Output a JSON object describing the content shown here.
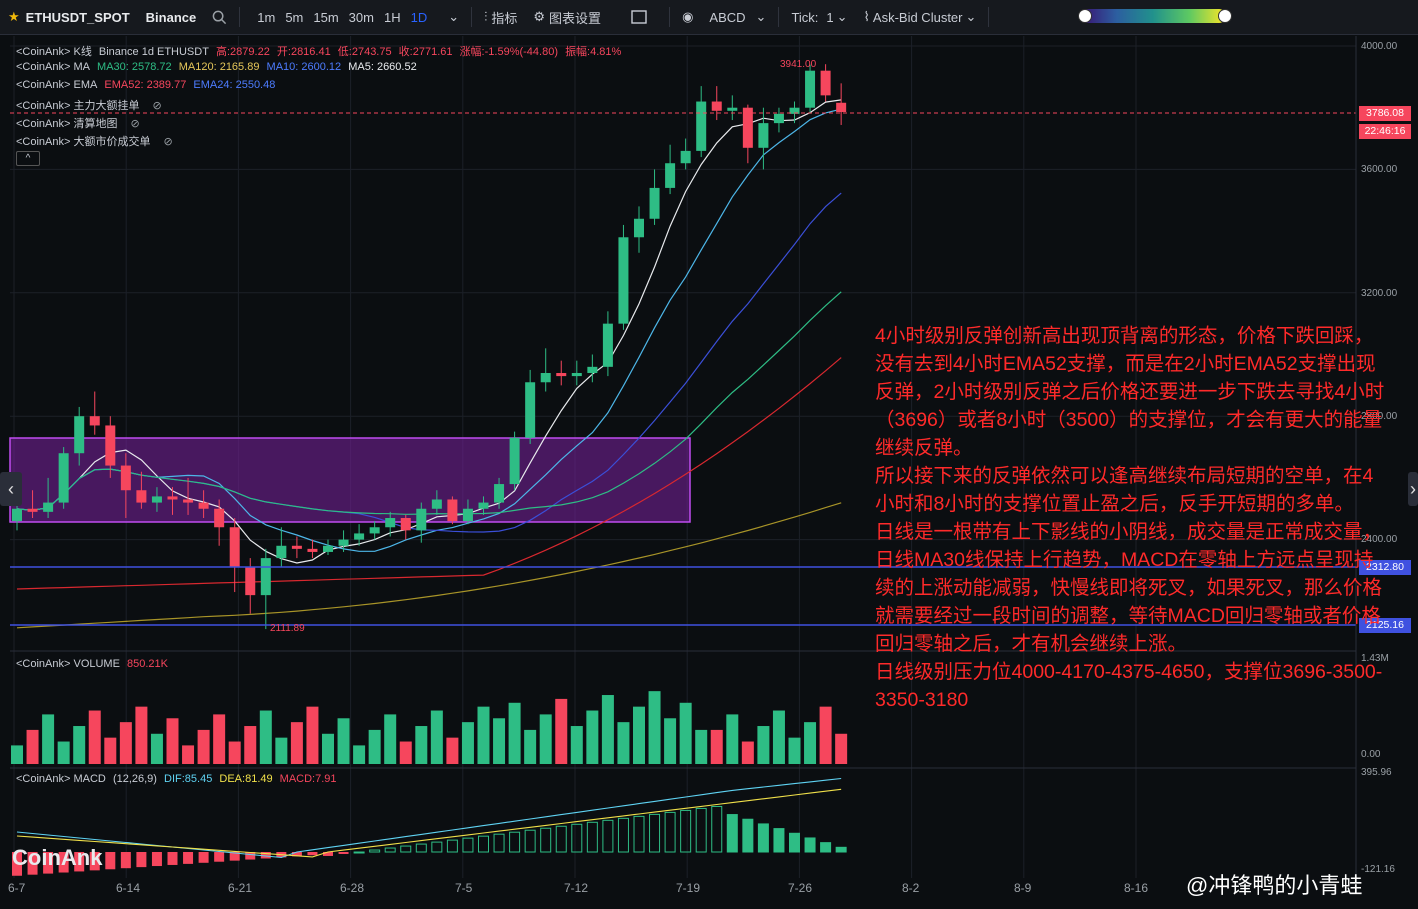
{
  "toolbar": {
    "symbol": "ETHUSDT_SPOT",
    "exchange": "Binance",
    "timeframes": [
      "1m",
      "5m",
      "15m",
      "30m",
      "1H",
      "1D"
    ],
    "active_timeframe": "1D",
    "indicators_label": "指标",
    "chart_settings_label": "图表设置",
    "drawing_label": "ABCD",
    "tick_label": "Tick:",
    "tick_value": "1",
    "cluster_label": "Ask-Bid Cluster"
  },
  "legend": {
    "kline": {
      "prefix": "<CoinAnk> K线",
      "source": "Binance 1d ETHUSDT",
      "high": "高:2879.22",
      "open": "开:2816.41",
      "low": "低:2743.75",
      "close": "收:2771.61",
      "change": "涨幅:-1.59%(-44.80)",
      "amp": "振幅:4.81%"
    },
    "ma": {
      "prefix": "<CoinAnk> MA",
      "ma30": "MA30: 2578.72",
      "ma120": "MA120: 2165.89",
      "ma10": "MA10: 2600.12",
      "ma5": "MA5: 2660.52"
    },
    "ema": {
      "prefix": "<CoinAnk> EMA",
      "ema52": "EMA52: 2389.77",
      "ema24": "EMA24: 2550.48"
    },
    "big_orders": "<CoinAnk> 主力大额挂单",
    "liq_map": "<CoinAnk> 清算地图",
    "big_trades": "<CoinAnk> 大额市价成交单",
    "volume_prefix": "<CoinAnk> VOLUME",
    "volume_value": "850.21K",
    "macd_prefix": "<CoinAnk> MACD",
    "macd_params": "(12,26,9)",
    "dif": "DIF:85.45",
    "dea": "DEA:81.49",
    "macd": "MACD:7.91"
  },
  "y_axis": [
    "4000.00",
    "3600.00",
    "3200.00",
    "2800.00",
    "2400.00"
  ],
  "price_tags": {
    "last": "3786.08",
    "time": "22:46:16",
    "level1": "2312.80",
    "level2": "2125.16",
    "high_mark": "3941.00",
    "low_mark": "2111.89"
  },
  "volume_axis": [
    "1.43M",
    "0.00"
  ],
  "macd_axis": [
    "395.96",
    "-121.16"
  ],
  "x_axis": [
    "6-7",
    "6-14",
    "6-21",
    "6-28",
    "7-5",
    "7-12",
    "7-19",
    "7-26",
    "8-2",
    "8-9",
    "8-16"
  ],
  "note": [
    "4小时级别反弹创新高出现顶背离的形态，价格下跌回踩，没有去到4小时EMA52支撑，而是在2小时EMA52支撑出现反弹，2小时级别反弹之后价格还要进一步下跌去寻找4小时（3696）或者8小时（3500）的支撑位，才会有更大的能量继续反弹。",
    "所以接下来的反弹依然可以逢高继续布局短期的空单，在4小时和8小时的支撑位置止盈之后，反手开短期的多单。",
    "日线是一根带有上下影线的小阴线，成交量是正常成交量，日线MA30线保持上行趋势，MACD在零轴上方远点呈现持续的上涨动能减弱，快慢线即将死叉，如果死叉，那么价格就需要经过一段时间的调整，等待MACD回归零轴或者价格回归零轴之后，才有机会继续上涨。",
    "日线级别压力位4000-4170-4375-4650，支撑位3696-3500-3350-3180"
  ],
  "watermark": "CoinAnk",
  "author": "@冲锋鸭的小青蛙",
  "colors": {
    "up": "#2ebd85",
    "down": "#f6465d",
    "box": "#7b2fa0",
    "level": "#3f51e0"
  },
  "chart_data": {
    "type": "candlestick",
    "note": "ETHUSDT daily candles, values estimated from price axis",
    "candles": [
      [
        2460,
        2500,
        2430,
        2530
      ],
      [
        2500,
        2490,
        2470,
        2560
      ],
      [
        2490,
        2520,
        2470,
        2600
      ],
      [
        2520,
        2680,
        2500,
        2700
      ],
      [
        2680,
        2800,
        2640,
        2830
      ],
      [
        2800,
        2770,
        2740,
        2880
      ],
      [
        2770,
        2640,
        2600,
        2800
      ],
      [
        2640,
        2560,
        2470,
        2680
      ],
      [
        2560,
        2520,
        2500,
        2620
      ],
      [
        2520,
        2540,
        2490,
        2570
      ],
      [
        2540,
        2530,
        2480,
        2570
      ],
      [
        2530,
        2520,
        2480,
        2600
      ],
      [
        2520,
        2500,
        2470,
        2560
      ],
      [
        2500,
        2440,
        2380,
        2530
      ],
      [
        2440,
        2310,
        2230,
        2470
      ],
      [
        2310,
        2220,
        2160,
        2340
      ],
      [
        2220,
        2340,
        2110,
        2370
      ],
      [
        2340,
        2380,
        2310,
        2440
      ],
      [
        2380,
        2370,
        2340,
        2410
      ],
      [
        2370,
        2360,
        2340,
        2400
      ],
      [
        2360,
        2380,
        2350,
        2400
      ],
      [
        2380,
        2400,
        2360,
        2430
      ],
      [
        2400,
        2420,
        2380,
        2450
      ],
      [
        2420,
        2440,
        2400,
        2460
      ],
      [
        2440,
        2470,
        2410,
        2490
      ],
      [
        2470,
        2430,
        2400,
        2480
      ],
      [
        2430,
        2500,
        2390,
        2520
      ],
      [
        2500,
        2530,
        2480,
        2560
      ],
      [
        2530,
        2460,
        2450,
        2540
      ],
      [
        2460,
        2500,
        2450,
        2530
      ],
      [
        2500,
        2520,
        2480,
        2540
      ],
      [
        2520,
        2580,
        2500,
        2600
      ],
      [
        2580,
        2730,
        2560,
        2750
      ],
      [
        2730,
        2910,
        2710,
        2950
      ],
      [
        2910,
        2940,
        2880,
        3020
      ],
      [
        2940,
        2930,
        2900,
        2980
      ],
      [
        2930,
        2940,
        2900,
        2980
      ],
      [
        2940,
        2960,
        2910,
        3000
      ],
      [
        2960,
        3100,
        2930,
        3140
      ],
      [
        3100,
        3380,
        3080,
        3420
      ],
      [
        3380,
        3440,
        3330,
        3480
      ],
      [
        3440,
        3540,
        3420,
        3600
      ],
      [
        3540,
        3620,
        3520,
        3680
      ],
      [
        3620,
        3660,
        3600,
        3700
      ],
      [
        3660,
        3820,
        3640,
        3870
      ],
      [
        3820,
        3790,
        3760,
        3870
      ],
      [
        3790,
        3800,
        3760,
        3840
      ],
      [
        3800,
        3670,
        3620,
        3810
      ],
      [
        3670,
        3750,
        3600,
        3800
      ],
      [
        3750,
        3780,
        3720,
        3800
      ],
      [
        3780,
        3800,
        3750,
        3820
      ],
      [
        3800,
        3920,
        3780,
        3940
      ],
      [
        3920,
        3840,
        3820,
        3941
      ],
      [
        3816,
        3786,
        3744,
        3879
      ]
    ]
  }
}
